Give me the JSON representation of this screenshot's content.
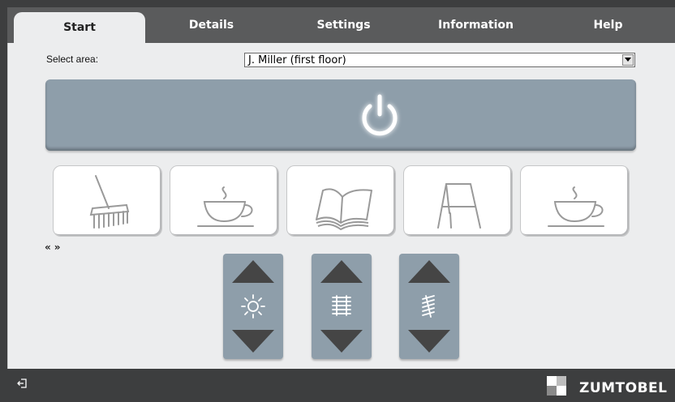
{
  "tabs": [
    {
      "label": "Start",
      "active": true
    },
    {
      "label": "Details",
      "active": false
    },
    {
      "label": "Settings",
      "active": false
    },
    {
      "label": "Information",
      "active": false
    },
    {
      "label": "Help",
      "active": false
    }
  ],
  "area": {
    "label": "Select area:",
    "selected": "J. Miller (first floor)"
  },
  "scenes": [
    {
      "icon": "broom-icon"
    },
    {
      "icon": "coffee-cup-icon"
    },
    {
      "icon": "open-book-icon"
    },
    {
      "icon": "flipchart-icon"
    },
    {
      "icon": "coffee-cup-icon"
    }
  ],
  "pager": {
    "prev": "«",
    "next": "»"
  },
  "controls": [
    {
      "icon": "brightness-icon"
    },
    {
      "icon": "blinds-icon"
    },
    {
      "icon": "slat-angle-icon"
    }
  ],
  "footer": {
    "brand": "ZUMTOBEL"
  },
  "colors": {
    "accent": "#8e9eaa",
    "dark": "#3d3e3f",
    "tabbar": "#5a5b5c"
  }
}
